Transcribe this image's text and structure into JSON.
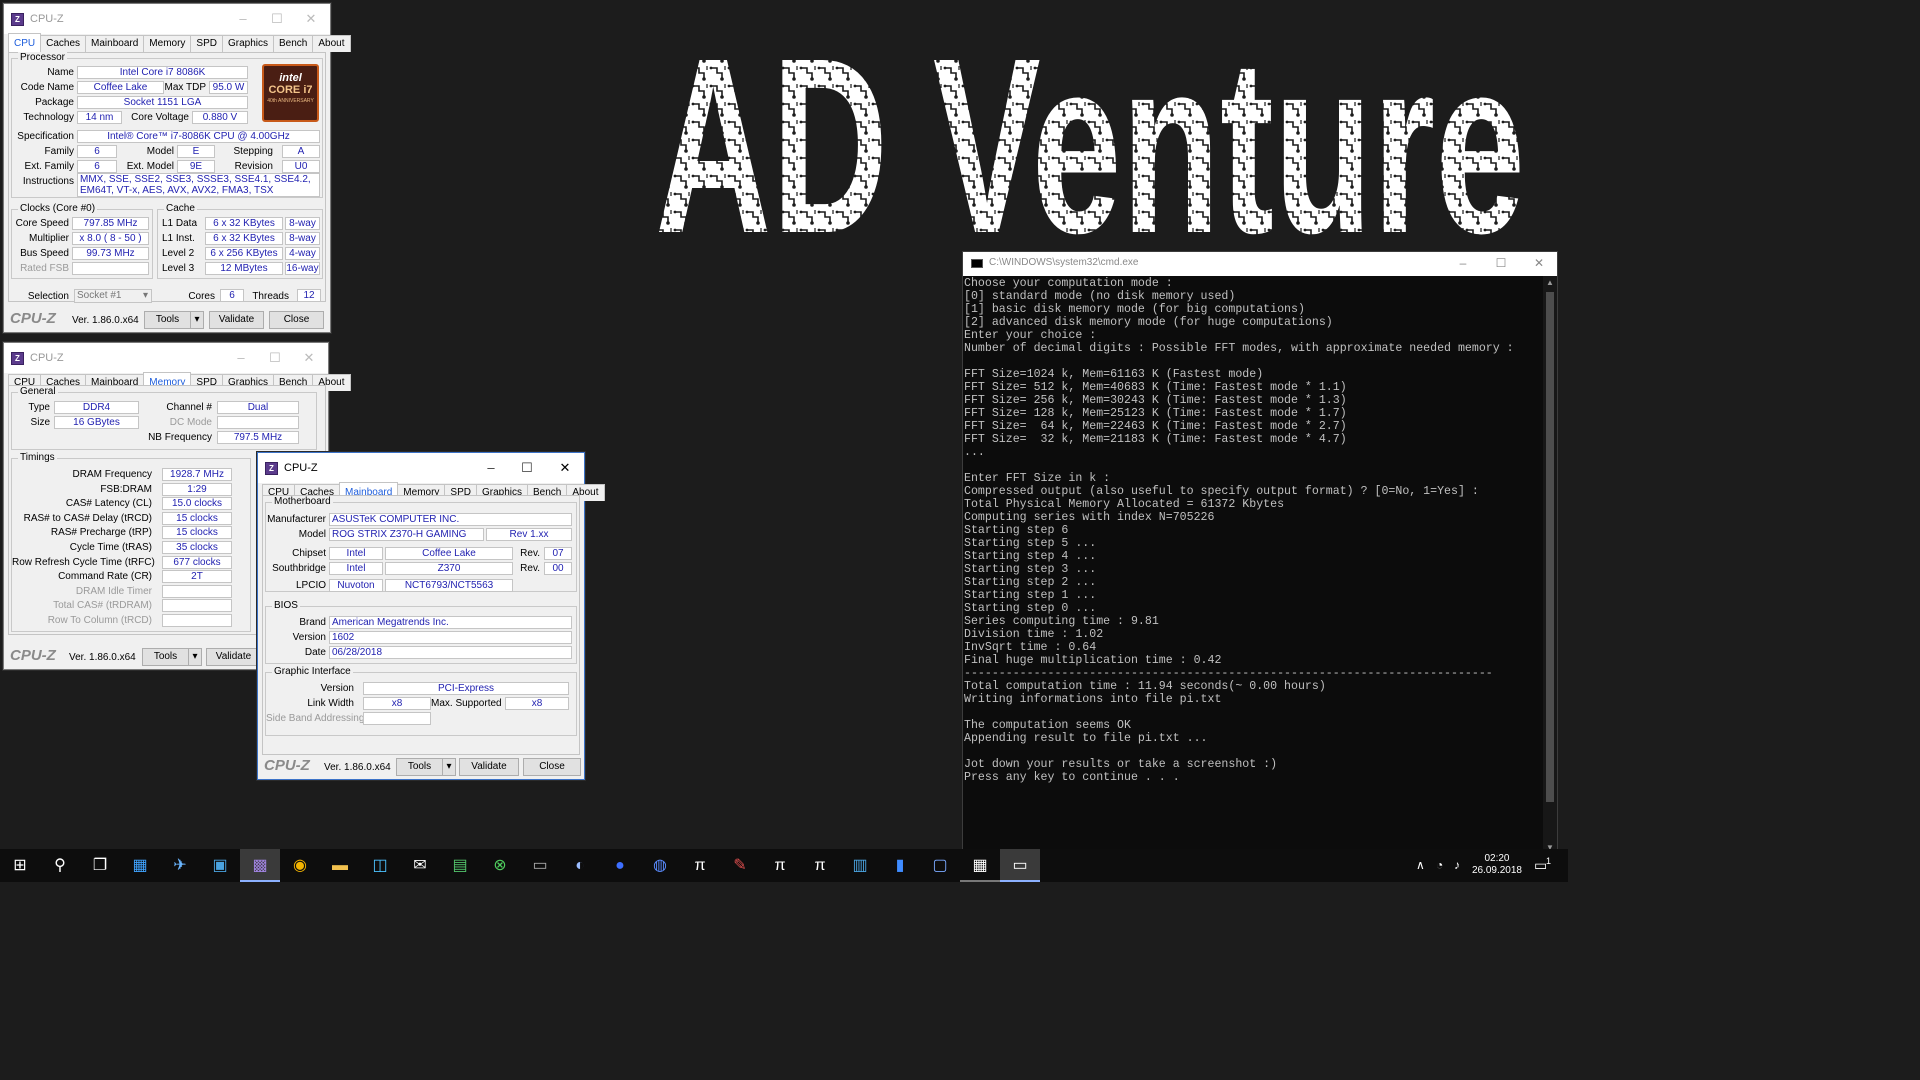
{
  "background": {
    "logo_text": "AD Venture"
  },
  "cpuz1": {
    "title": "CPU-Z",
    "tabs": [
      "CPU",
      "Caches",
      "Mainboard",
      "Memory",
      "SPD",
      "Graphics",
      "Bench",
      "About"
    ],
    "selected_tab": "CPU",
    "processor_label": "Processor",
    "name_label": "Name",
    "name": "Intel Core i7 8086K",
    "codename_label": "Code Name",
    "codename": "Coffee Lake",
    "maxtdp_label": "Max TDP",
    "maxtdp": "95.0 W",
    "package_label": "Package",
    "package": "Socket 1151 LGA",
    "technology_label": "Technology",
    "technology": "14 nm",
    "corevoltage_label": "Core Voltage",
    "corevoltage": "0.880 V",
    "intel_logo": {
      "brand": "intel",
      "model": "CORE i7",
      "sub": "40th ANNIVERSARY"
    },
    "spec_label": "Specification",
    "spec": "Intel® Core™ i7-8086K CPU @ 4.00GHz",
    "family_label": "Family",
    "family": "6",
    "model_label": "Model",
    "model": "E",
    "stepping_label": "Stepping",
    "stepping": "A",
    "extfamily_label": "Ext. Family",
    "extfamily": "6",
    "extmodel_label": "Ext. Model",
    "extmodel": "9E",
    "revision_label": "Revision",
    "revision": "U0",
    "instructions_label": "Instructions",
    "instructions": "MMX, SSE, SSE2, SSE3, SSSE3, SSE4.1, SSE4.2, EM64T, VT-x, AES, AVX, AVX2, FMA3, TSX",
    "clocks_label": "Clocks (Core #0)",
    "corespeed_label": "Core Speed",
    "corespeed": "797.85 MHz",
    "multiplier_label": "Multiplier",
    "multiplier": "x 8.0 ( 8 - 50 )",
    "busspeed_label": "Bus Speed",
    "busspeed": "99.73 MHz",
    "ratedfsb_label": "Rated FSB",
    "cache_label": "Cache",
    "l1d_label": "L1 Data",
    "l1d": "6 x 32 KBytes",
    "l1d_way": "8-way",
    "l1i_label": "L1 Inst.",
    "l1i": "6 x 32 KBytes",
    "l1i_way": "8-way",
    "l2_label": "Level 2",
    "l2": "6 x 256 KBytes",
    "l2_way": "4-way",
    "l3_label": "Level 3",
    "l3": "12 MBytes",
    "l3_way": "16-way",
    "selection_label": "Selection",
    "selection": "Socket #1",
    "cores_label": "Cores",
    "cores": "6",
    "threads_label": "Threads",
    "threads": "12",
    "brand": "CPU-Z",
    "version": "Ver. 1.86.0.x64",
    "tools": "Tools",
    "validate": "Validate",
    "close": "Close"
  },
  "cpuz2": {
    "title": "CPU-Z",
    "tabs": [
      "CPU",
      "Caches",
      "Mainboard",
      "Memory",
      "SPD",
      "Graphics",
      "Bench",
      "About"
    ],
    "selected_tab": "Memory",
    "general_label": "General",
    "type_label": "Type",
    "type": "DDR4",
    "size_label": "Size",
    "size": "16 GBytes",
    "channel_label": "Channel #",
    "channel": "Dual",
    "dcmode_label": "DC Mode",
    "nbfreq_label": "NB Frequency",
    "nbfreq": "797.5 MHz",
    "timings_label": "Timings",
    "timings": [
      {
        "label": "DRAM Frequency",
        "value": "1928.7 MHz",
        "gray": false
      },
      {
        "label": "FSB:DRAM",
        "value": "1:29",
        "gray": false
      },
      {
        "label": "CAS# Latency (CL)",
        "value": "15.0 clocks",
        "gray": false
      },
      {
        "label": "RAS# to CAS# Delay (tRCD)",
        "value": "15 clocks",
        "gray": false
      },
      {
        "label": "RAS# Precharge (tRP)",
        "value": "15 clocks",
        "gray": false
      },
      {
        "label": "Cycle Time (tRAS)",
        "value": "35 clocks",
        "gray": false
      },
      {
        "label": "Row Refresh Cycle Time (tRFC)",
        "value": "677 clocks",
        "gray": false
      },
      {
        "label": "Command Rate (CR)",
        "value": "2T",
        "gray": false
      },
      {
        "label": "DRAM Idle Timer",
        "value": "",
        "gray": true
      },
      {
        "label": "Total CAS# (tRDRAM)",
        "value": "",
        "gray": true
      },
      {
        "label": "Row To Column (tRCD)",
        "value": "",
        "gray": true
      }
    ],
    "brand": "CPU-Z",
    "version": "Ver. 1.86.0.x64",
    "tools": "Tools",
    "validate": "Validate"
  },
  "cpuz3": {
    "title": "CPU-Z",
    "tabs": [
      "CPU",
      "Caches",
      "Mainboard",
      "Memory",
      "SPD",
      "Graphics",
      "Bench",
      "About"
    ],
    "selected_tab": "Mainboard",
    "motherboard_label": "Motherboard",
    "manufacturer_label": "Manufacturer",
    "manufacturer": "ASUSTeK COMPUTER INC.",
    "model_label": "Model",
    "model": "ROG STRIX Z370-H GAMING",
    "model_rev": "Rev 1.xx",
    "chipset_label": "Chipset",
    "chipset_vendor": "Intel",
    "chipset_name": "Coffee Lake",
    "rev_label": "Rev.",
    "chipset_rev": "07",
    "southbridge_label": "Southbridge",
    "sb_vendor": "Intel",
    "sb_name": "Z370",
    "sb_rev": "00",
    "lpcio_label": "LPCIO",
    "lpcio_vendor": "Nuvoton",
    "lpcio_name": "NCT6793/NCT5563",
    "bios_label": "BIOS",
    "brand_label": "Brand",
    "bios_brand": "American Megatrends Inc.",
    "version_label": "Version",
    "bios_version": "1602",
    "date_label": "Date",
    "bios_date": "06/28/2018",
    "gi_label": "Graphic Interface",
    "gi_version_label": "Version",
    "gi_version": "PCI-Express",
    "linkwidth_label": "Link Width",
    "linkwidth": "x8",
    "maxsupported_label": "Max. Supported",
    "maxsupported": "x8",
    "sideband_label": "Side Band Addressing",
    "brand": "CPU-Z",
    "version": "Ver. 1.86.0.x64",
    "tools": "Tools",
    "validate": "Validate",
    "close": "Close"
  },
  "cmd": {
    "title": "C:\\WINDOWS\\system32\\cmd.exe",
    "output": "Choose your computation mode :\n[0] standard mode (no disk memory used)\n[1] basic disk memory mode (for big computations)\n[2] advanced disk memory mode (for huge computations)\nEnter your choice :\nNumber of decimal digits : Possible FFT modes, with approximate needed memory :\n\nFFT Size=1024 k, Mem=61163 K (Fastest mode)\nFFT Size= 512 k, Mem=40683 K (Time: Fastest mode * 1.1)\nFFT Size= 256 k, Mem=30243 K (Time: Fastest mode * 1.3)\nFFT Size= 128 k, Mem=25123 K (Time: Fastest mode * 1.7)\nFFT Size=  64 k, Mem=22463 K (Time: Fastest mode * 2.7)\nFFT Size=  32 k, Mem=21183 K (Time: Fastest mode * 4.7)\n...\n\nEnter FFT Size in k :\nCompressed output (also useful to specify output format) ? [0=No, 1=Yes] :\nTotal Physical Memory Allocated = 61372 Kbytes\nComputing series with index N=705226\nStarting step 6\nStarting step 5 ...\nStarting step 4 ...\nStarting step 3 ...\nStarting step 2 ...\nStarting step 1 ...\nStarting step 0 ...\nSeries computing time : 9.81\nDivision time : 1.02\nInvSqrt time : 0.64\nFinal huge multiplication time : 0.42\n----------------------------------------------------------------------------\nTotal computation time : 11.94 seconds(~ 0.00 hours)\nWriting informations into file pi.txt\n\nThe computation seems OK\nAppending result to file pi.txt ...\n\nJot down your results or take a screenshot :)\nPress any key to continue . . ."
  },
  "taskbar": {
    "time": "02:20",
    "date": "26.09.2018",
    "pi_label": "π",
    "notification_count": "1"
  }
}
